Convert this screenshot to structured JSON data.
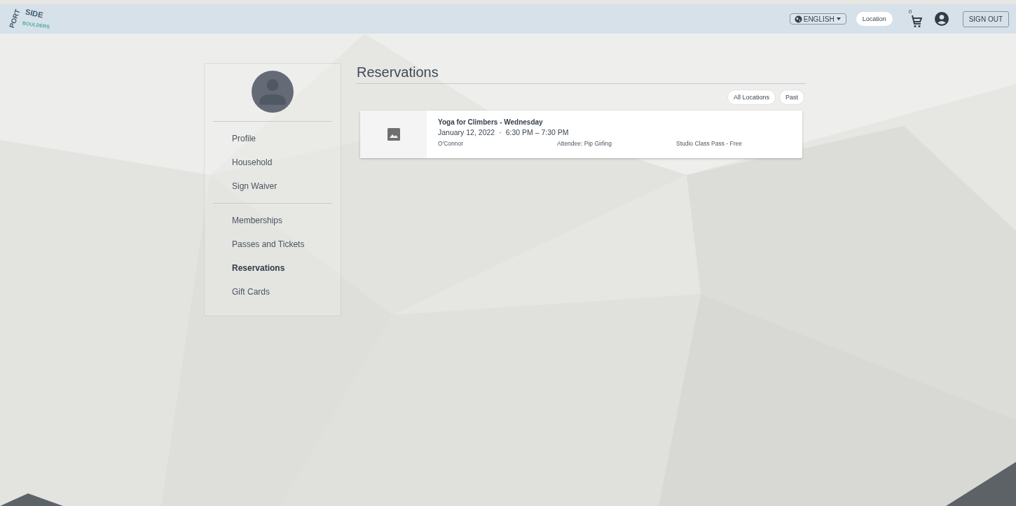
{
  "header": {
    "logo": {
      "top": "SIDE",
      "side": "PORT",
      "bottom": "BOULDERS"
    },
    "language": "ENGLISH",
    "location": "Location",
    "cart_count": "0",
    "sign_out": "SIGN OUT"
  },
  "sidebar": {
    "groups": [
      [
        {
          "label": "Profile",
          "selected": false
        },
        {
          "label": "Household",
          "selected": false
        },
        {
          "label": "Sign Waiver",
          "selected": false
        }
      ],
      [
        {
          "label": "Memberships",
          "selected": false
        },
        {
          "label": "Passes and Tickets",
          "selected": false
        },
        {
          "label": "Reservations",
          "selected": true
        },
        {
          "label": "Gift Cards",
          "selected": false
        }
      ]
    ]
  },
  "main": {
    "title": "Reservations",
    "filters": [
      "All Locations",
      "Past"
    ],
    "reservations": [
      {
        "title": "Yoga for Climbers - Wednesday",
        "date": "January 12, 2022",
        "separator": "·",
        "time": "6:30 PM – 7:30 PM",
        "location": "O'Connor",
        "attendee": "Attendee: Pip Girling",
        "pass": "Studio Class Pass - Free"
      }
    ]
  }
}
